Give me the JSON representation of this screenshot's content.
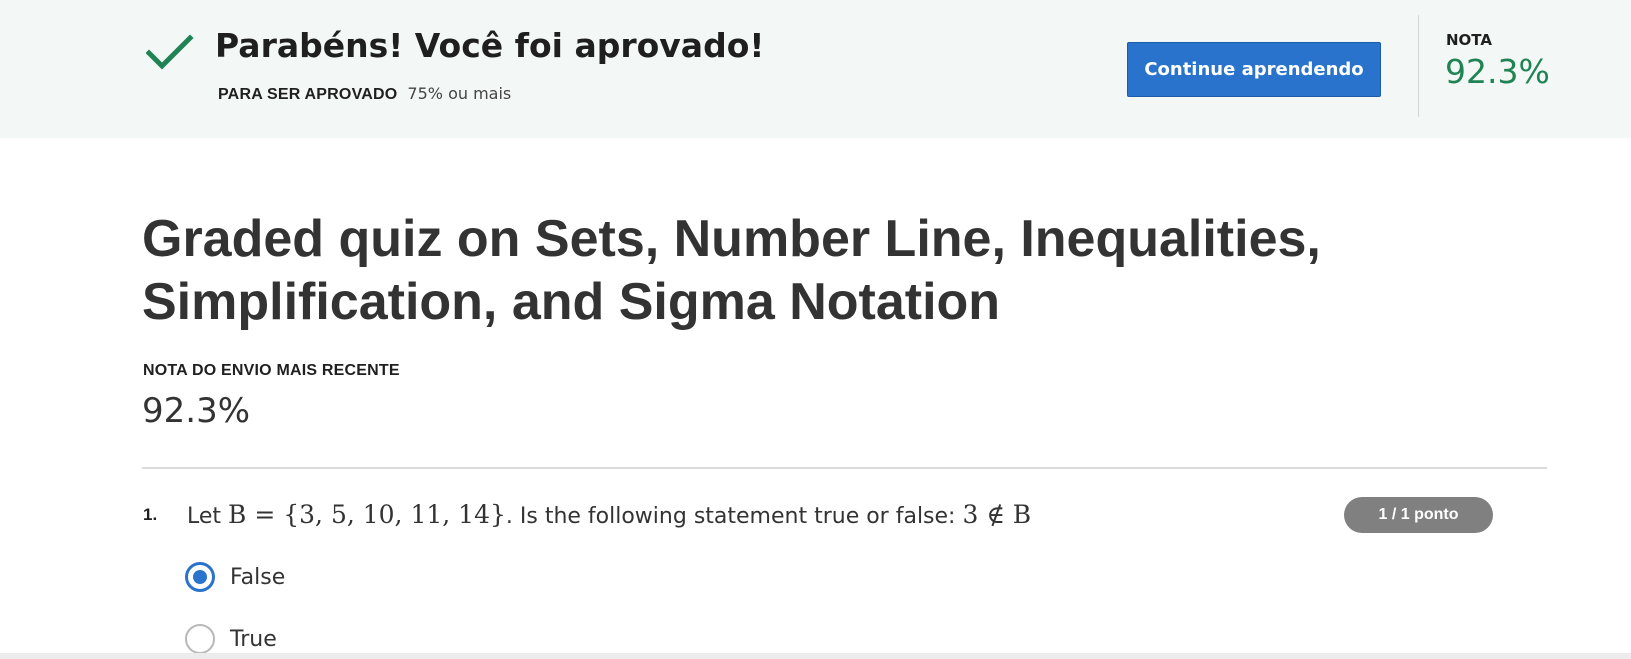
{
  "banner": {
    "title": "Parabéns! Você foi aprovado!",
    "pass_label": "PARA SER APROVADO",
    "pass_value": "75% ou mais",
    "continue_label": "Continue aprendendo",
    "grade_label": "NOTA",
    "grade_value": "92.3%",
    "accent_color": "#1f8354",
    "button_color": "#2a73cc"
  },
  "main": {
    "title": "Graded quiz on Sets, Number Line, Inequalities, Simplification, and Sigma Notation",
    "recent_label": "NOTA DO ENVIO MAIS RECENTE",
    "recent_value": "92.3%"
  },
  "questions": [
    {
      "number": "1.",
      "text_prefix": "Let",
      "set_expr": "B = {3, 5, 10, 11, 14}",
      "text_middle": ". Is the following statement true or false:",
      "statement_expr": "3 ∉ B",
      "points": "1 / 1 ponto",
      "options": [
        {
          "label": "False",
          "selected": true
        },
        {
          "label": "True",
          "selected": false
        }
      ]
    }
  ]
}
